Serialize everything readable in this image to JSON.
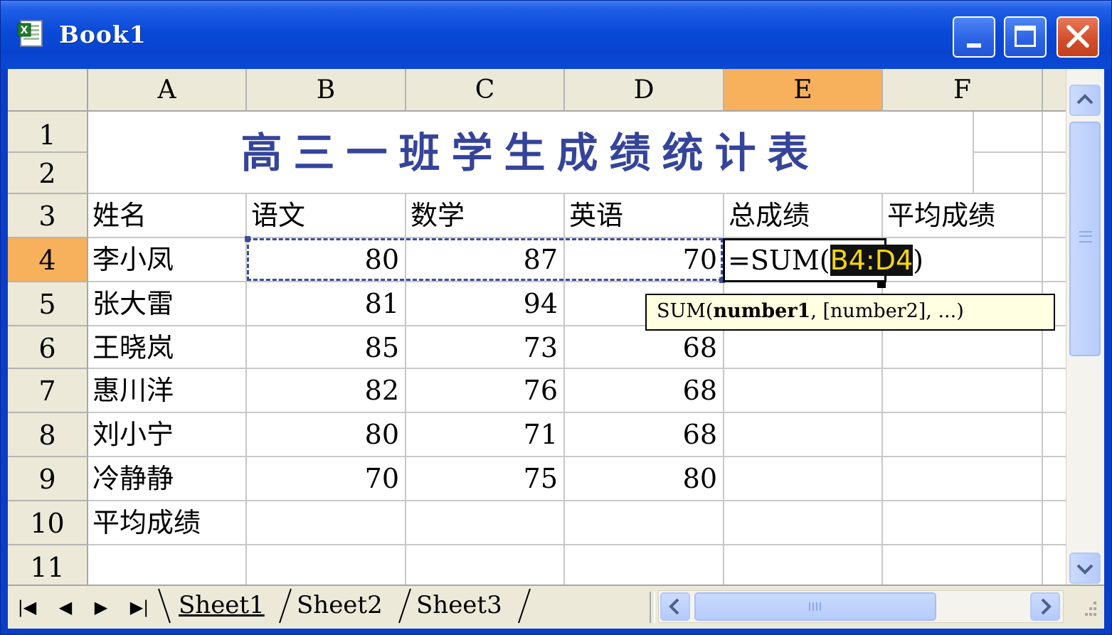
{
  "window": {
    "title": "Book1",
    "icon": "excel-icon",
    "controls": [
      "minimize-icon",
      "maximize-icon",
      "close-icon"
    ],
    "titlebar_color": "#0a4ad8"
  },
  "spreadsheet": {
    "column_headers": [
      "A",
      "B",
      "C",
      "D",
      "E",
      "F"
    ],
    "active_column": "E",
    "row_headers": [
      "1",
      "2",
      "3",
      "4",
      "5",
      "6",
      "7",
      "8",
      "9",
      "10",
      "11"
    ],
    "active_row": "4",
    "title_banner": "高三一班学生成绩统计表",
    "header_row": [
      "姓名",
      "语文",
      "数学",
      "英语",
      "总成绩",
      "平均成绩"
    ],
    "rows": [
      {
        "name": "李小凤",
        "chinese": "80",
        "math": "87",
        "english": "70"
      },
      {
        "name": "张大雷",
        "chinese": "81",
        "math": "94",
        "english": ""
      },
      {
        "name": "王晓岚",
        "chinese": "85",
        "math": "73",
        "english": "68"
      },
      {
        "name": "惠川洋",
        "chinese": "82",
        "math": "76",
        "english": "68"
      },
      {
        "name": "刘小宁",
        "chinese": "80",
        "math": "71",
        "english": "68"
      },
      {
        "name": "冷静静",
        "chinese": "70",
        "math": "75",
        "english": "80"
      }
    ],
    "footer_label": "平均成绩",
    "editing": {
      "prefix": "=SUM(",
      "range": "B4:D4",
      "suffix": ")"
    },
    "tooltip": {
      "func": "SUM(",
      "bold_arg": "number1",
      "rest": ", [number2], ...)"
    },
    "highlight_color": "#f7b05c",
    "title_color": "#35449a"
  },
  "sheet_nav": {
    "buttons": [
      "first-sheet-icon",
      "prev-sheet-icon",
      "next-sheet-icon",
      "last-sheet-icon"
    ],
    "first": "|◀",
    "prev": "◀",
    "next": "▶",
    "last": "▶|"
  },
  "sheet_tabs": [
    "Sheet1",
    "Sheet2",
    "Sheet3"
  ],
  "active_sheet": "Sheet1"
}
